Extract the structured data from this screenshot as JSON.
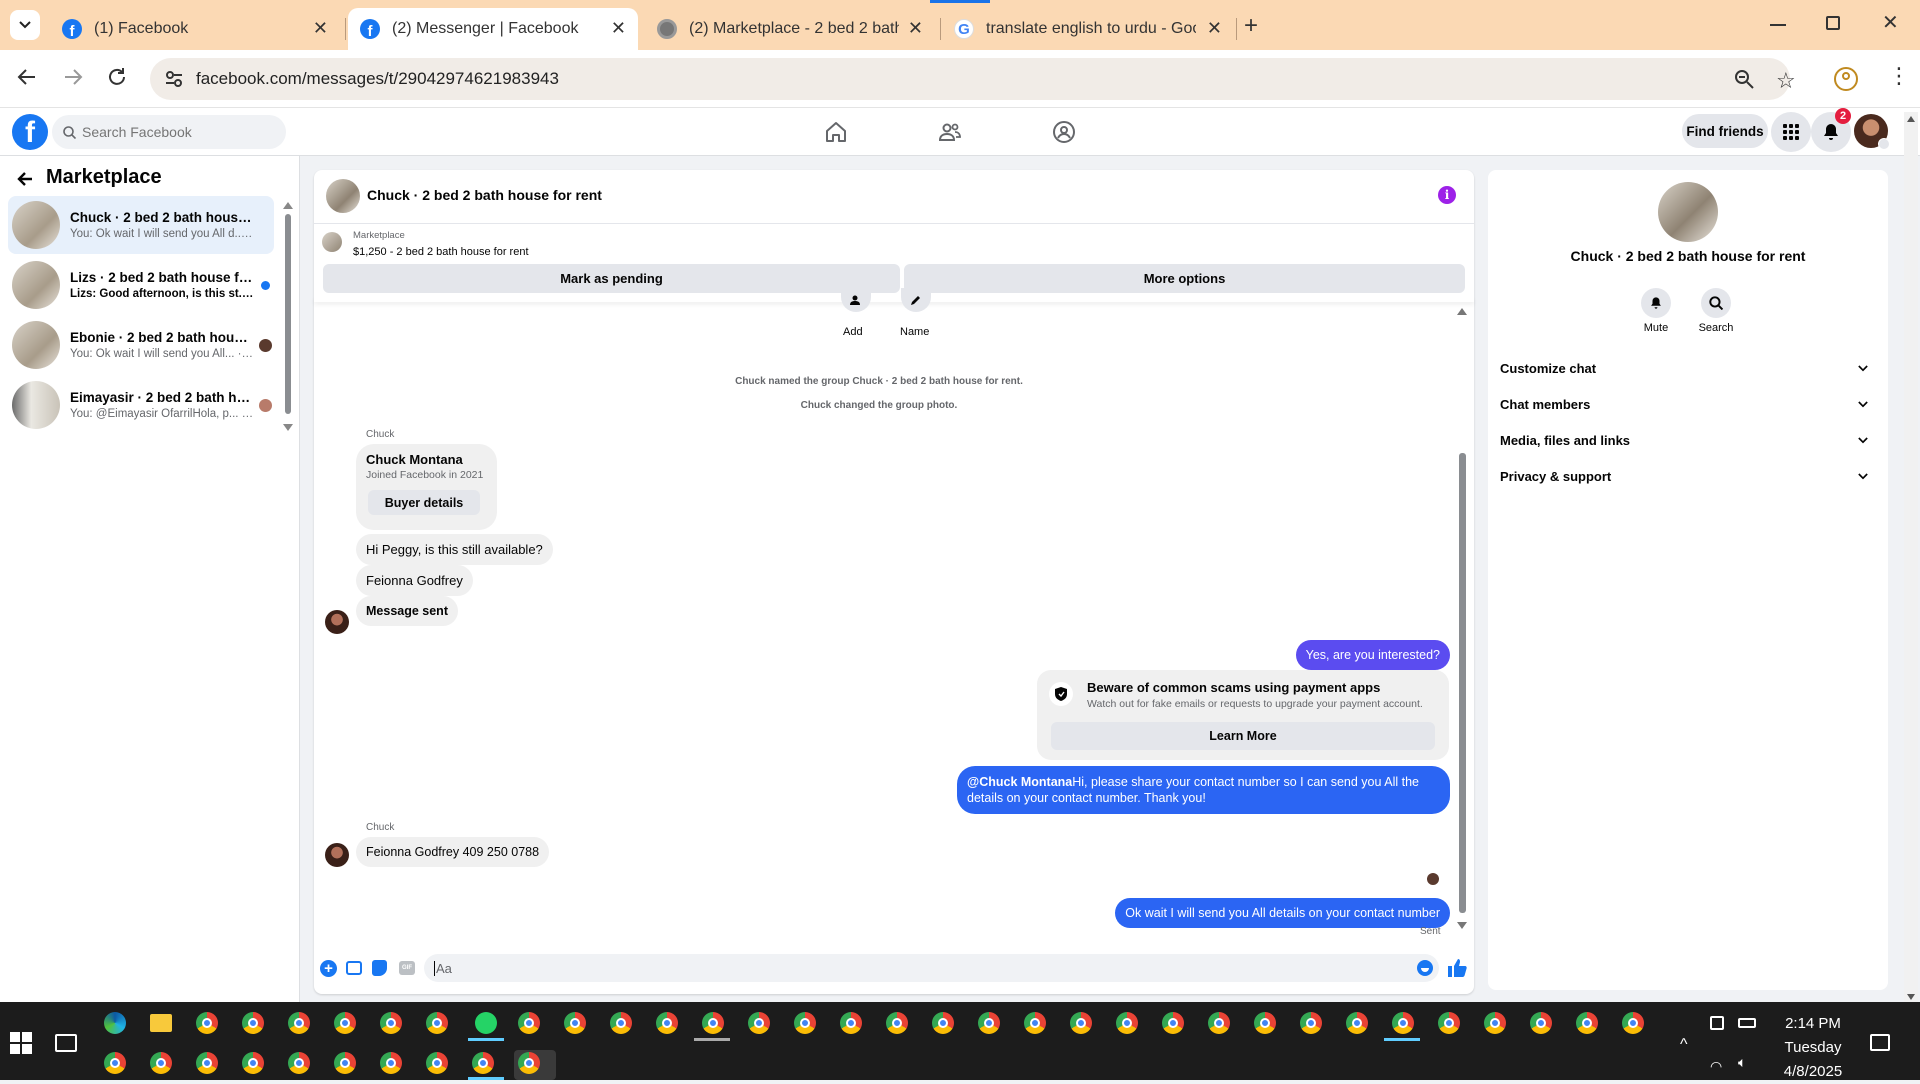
{
  "browser": {
    "tabs": [
      {
        "title": "(1) Facebook",
        "icon": "facebook-icon"
      },
      {
        "title": "(2) Messenger | Facebook",
        "icon": "facebook-icon"
      },
      {
        "title": "(2) Marketplace - 2 bed 2 bath h",
        "icon": "globe-icon"
      },
      {
        "title": "translate english to urdu - Goo",
        "icon": "google-icon"
      }
    ],
    "url": "facebook.com/messages/t/29042974621983943"
  },
  "fb_header": {
    "search_placeholder": "Search Facebook",
    "find_friends": "Find friends",
    "notifications_count": "2"
  },
  "sidebar": {
    "title": "Marketplace",
    "conversations": [
      {
        "name": "Chuck · 2 bed 2 bath house for ...",
        "preview": "You: Ok wait I will send you All d... · 1m"
      },
      {
        "name": "Lizs · 2 bed 2 bath house for r...",
        "preview": "Lizs: Good afternoon, is this st... · 1m"
      },
      {
        "name": "Ebonie · 2 bed 2 bath house ...",
        "preview": "You: Ok wait I will send you All... · 2m"
      },
      {
        "name": "Eimayasir · 2 bed 2 bath hou...",
        "preview": "You: @Eimayasir OfarrilHola, p... · 4m"
      }
    ]
  },
  "chat": {
    "title": "Chuck · 2 bed 2 bath house for rent",
    "listing_label": "Marketplace",
    "listing_price_title": "$1,250 - 2 bed 2 bath house for rent",
    "mark_pending": "Mark as pending",
    "more_options": "More options",
    "add_label": "Add",
    "name_label": "Name",
    "event1": "Chuck named the group Chuck · 2 bed 2 bath house for rent.",
    "event2": "Chuck changed the group photo.",
    "sender1": "Chuck",
    "card_name": "Chuck Montana",
    "card_sub": "Joined Facebook in 2021",
    "buyer_details": "Buyer details",
    "msg1": "Hi Peggy, is this still available?",
    "msg2": "Feionna Godfrey",
    "msg3": "Message sent",
    "my_msg1": "Yes, are you interested?",
    "scam_title": "Beware of common scams using payment apps",
    "scam_sub": "Watch out for fake emails or requests to upgrade your payment account.",
    "learn_more": "Learn More",
    "my_msg2_mention": "@Chuck Montana",
    "my_msg2_text": "Hi, please share your contact number so I can send you All the details on your contact number. Thank you!",
    "sender2": "Chuck",
    "msg4": "Feionna Godfrey 409 250 0788",
    "my_msg3": "Ok wait I will send you All details on your contact number",
    "sent_status": "Sent",
    "composer_placeholder": "Aa"
  },
  "details": {
    "title": "Chuck · 2 bed 2 bath house for rent",
    "mute": "Mute",
    "search": "Search",
    "sections": [
      "Customize chat",
      "Chat members",
      "Media, files and links",
      "Privacy & support"
    ]
  },
  "taskbar": {
    "time": "2:14 PM",
    "day": "Tuesday",
    "date": "4/8/2025"
  },
  "colors": {
    "accent": "#1877f2",
    "my_bubble": "#5b4cf0",
    "my_bubble_alt": "#2b65f3",
    "tabstrip": "#fbd9b4"
  }
}
